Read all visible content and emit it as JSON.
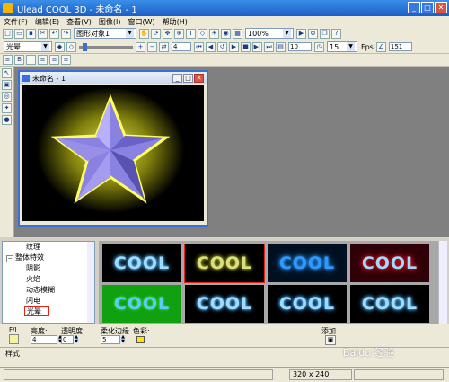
{
  "app": {
    "title": "Ulead COOL 3D - 未命名 - 1"
  },
  "menu": [
    "文件(F)",
    "编辑(E)",
    "查看(V)",
    "图像(I)",
    "窗口(W)",
    "帮助(H)"
  ],
  "toolbar1": {
    "object_select": "图形对象1",
    "zoom": "100%"
  },
  "toolbar2": {
    "effect_select": "光晕",
    "frame": "4",
    "total_frames": "10",
    "fps_value": "15",
    "fps_label": "Fps",
    "angle_value": "151"
  },
  "document": {
    "title": "未命名 - 1"
  },
  "tree": {
    "items": [
      "纹理",
      "整体特效",
      "阴影",
      "火焰",
      "动态模糊",
      "闪电",
      "光晕"
    ]
  },
  "gallery": {
    "thumbnails": [
      "COOL",
      "COOL",
      "COOL",
      "COOL",
      "COOL",
      "COOL",
      "COOL",
      "COOL"
    ]
  },
  "params": {
    "fi_label": "F/I",
    "brightness_label": "亮度:",
    "brightness_value": "4",
    "opacity_label": "透明度:",
    "opacity_value": "0",
    "soft_edge_label": "柔化边缘",
    "soft_edge_value": "5",
    "color_label": "色彩:",
    "add_label": "添加",
    "style_label": "样式"
  },
  "status": {
    "dimensions": "320 x 240"
  },
  "colors": {
    "highlight": "#e8231c",
    "glow_yellow": "#e8e817",
    "color_swatch": "#ffe600"
  },
  "watermark": "Baidu 经验"
}
